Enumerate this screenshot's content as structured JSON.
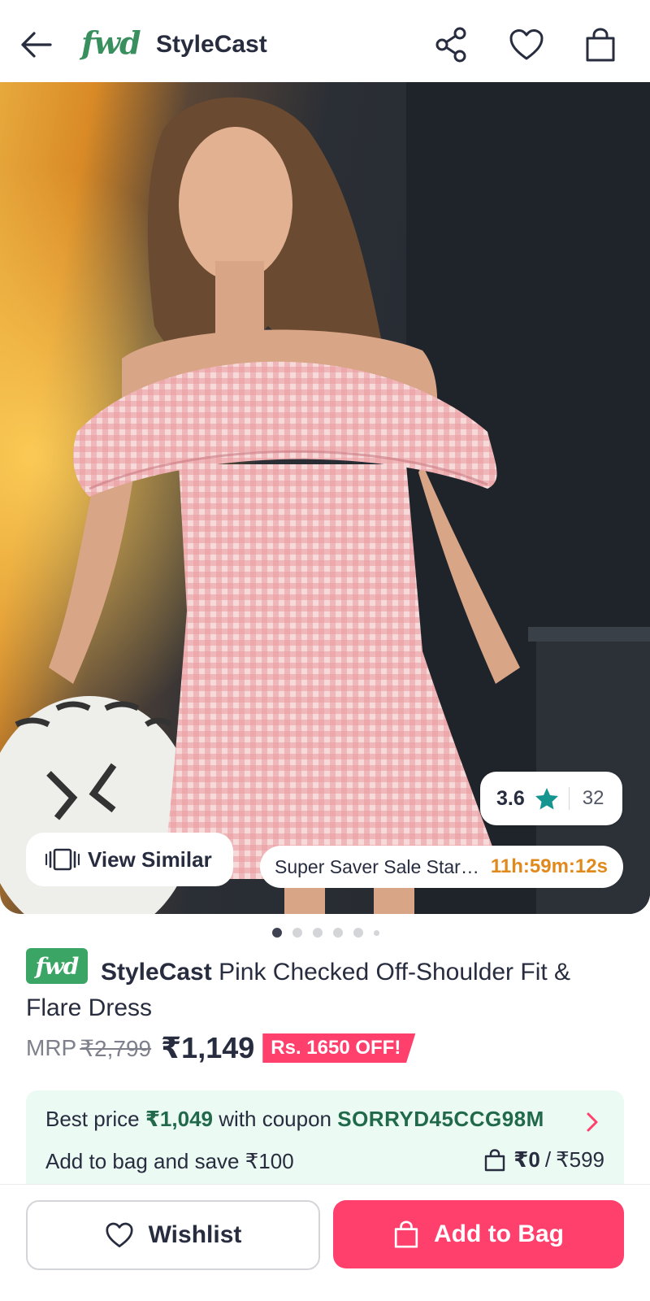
{
  "header": {
    "brand_logo": "fwd",
    "brand_name": "StyleCast",
    "icons": [
      "back-arrow-icon",
      "share-icon",
      "heart-icon",
      "bag-icon"
    ]
  },
  "hero": {
    "rating": {
      "value": "3.6",
      "count": "32",
      "star_color": "#14958f"
    },
    "view_similar_label": "View Similar",
    "sale_text": "Super Saver Sale Star…",
    "sale_timer": "11h:59m:12s",
    "image_count": 6,
    "active_image_index": 0
  },
  "product": {
    "badge": "fwd",
    "brand": "StyleCast",
    "name": "Pink Checked Off-Shoulder Fit & Flare Dress",
    "mrp_label": "MRP",
    "mrp_value": "₹2,799",
    "price": "₹1,149",
    "discount_badge": "Rs. 1650 OFF!"
  },
  "coupon": {
    "best_price_prefix": "Best price",
    "best_price_value": "₹1,049",
    "best_price_middle": "with coupon",
    "code": "SORRYD45CCG98M",
    "save_text": "Add to bag and save ₹100",
    "bag_current": "₹0",
    "bag_separator": "/",
    "bag_target": "₹599"
  },
  "actions": {
    "wishlist_label": "Wishlist",
    "add_to_bag_label": "Add to Bag"
  },
  "colors": {
    "brand_pink": "#ff3f6c",
    "fwd_green": "#3aa565",
    "timer_orange": "#e08a1e",
    "coupon_bg": "#ebfaf3"
  }
}
